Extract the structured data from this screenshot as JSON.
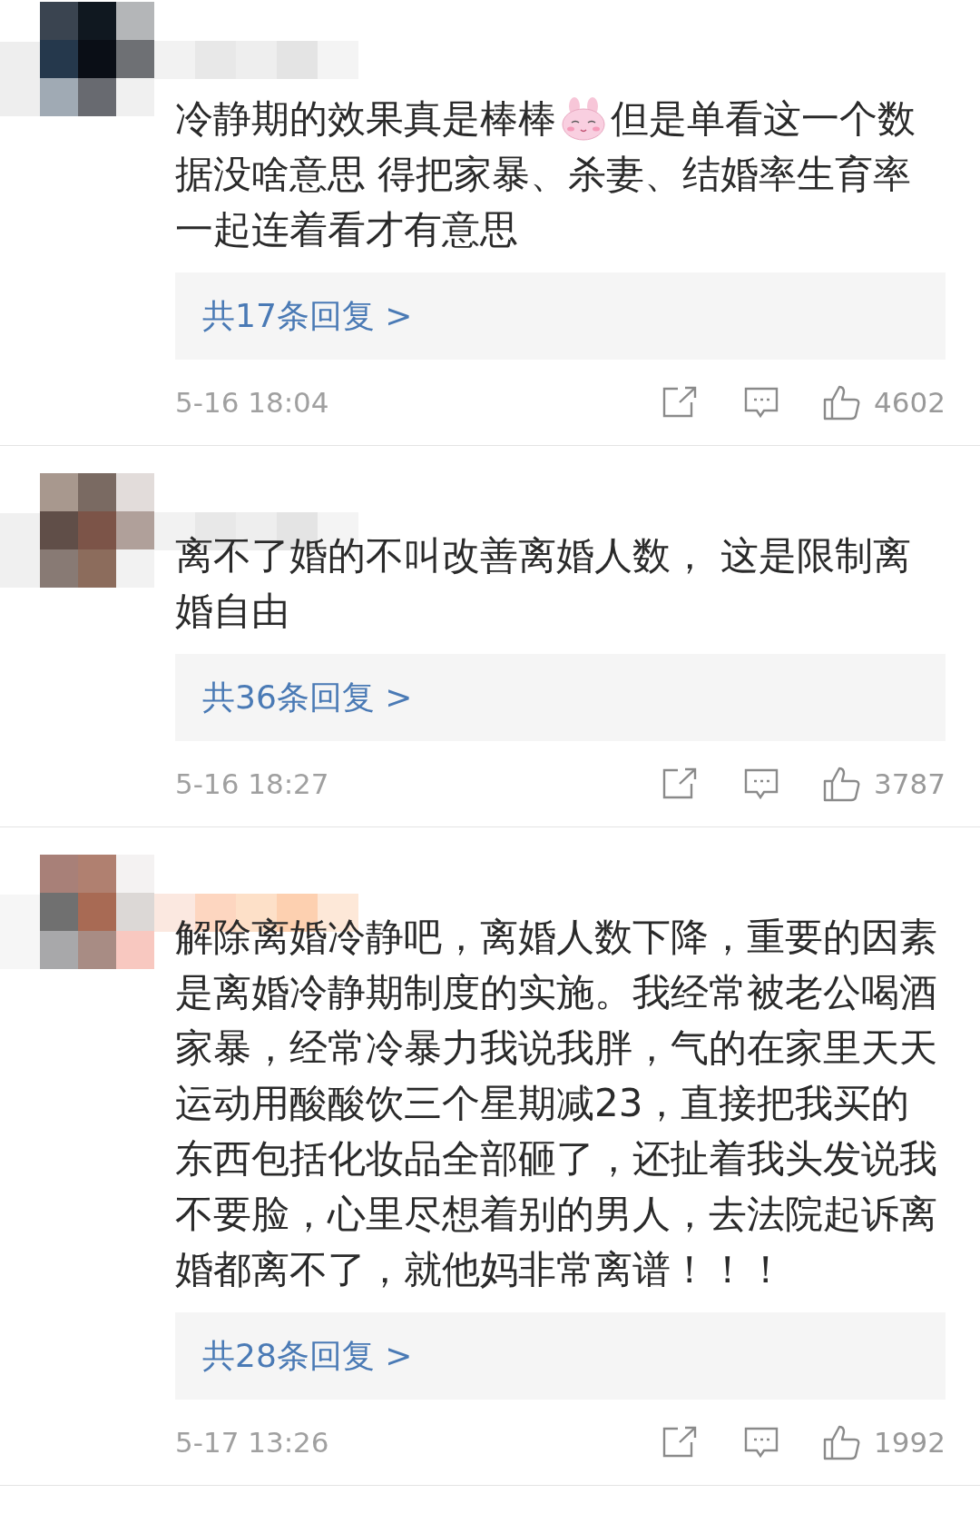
{
  "comments": [
    {
      "content": [
        {
          "kind": "text",
          "text": "冷静期的效果真是棒棒"
        },
        {
          "kind": "emoji"
        },
        {
          "kind": "text",
          "text": "但是单看这一个数"
        },
        {
          "kind": "block",
          "text": "据没啥意思 得把家暴、杀妻、结婚率生育率一起连着看才有意思"
        }
      ],
      "replies": "共17条回复 >",
      "time": "5-16 18:04",
      "likes": "4602"
    },
    {
      "content": [
        {
          "kind": "text",
          "text": "离不了婚的不叫改善离婚人数， 这是限制离婚自由"
        }
      ],
      "replies": "共36条回复 >",
      "time": "5-16 18:27",
      "likes": "3787"
    },
    {
      "content": [
        {
          "kind": "text",
          "text": "解除离婚冷静吧，离婚人数下降，重要的因素是离婚冷静期制度的实施。我经常被老公喝酒家暴，经常冷暴力我说我胖，气的在家里天天运动用酸酸饮三个星期减23，直接把我买的东西包括化妆品全部砸了，还扯着我头发说我不要脸，心里尽想着别的男人，去法院起诉离婚都离不了，就他妈非常离谱！！！"
        }
      ],
      "replies": "共28条回复 >",
      "time": "5-17 13:26",
      "likes": "1992"
    }
  ]
}
